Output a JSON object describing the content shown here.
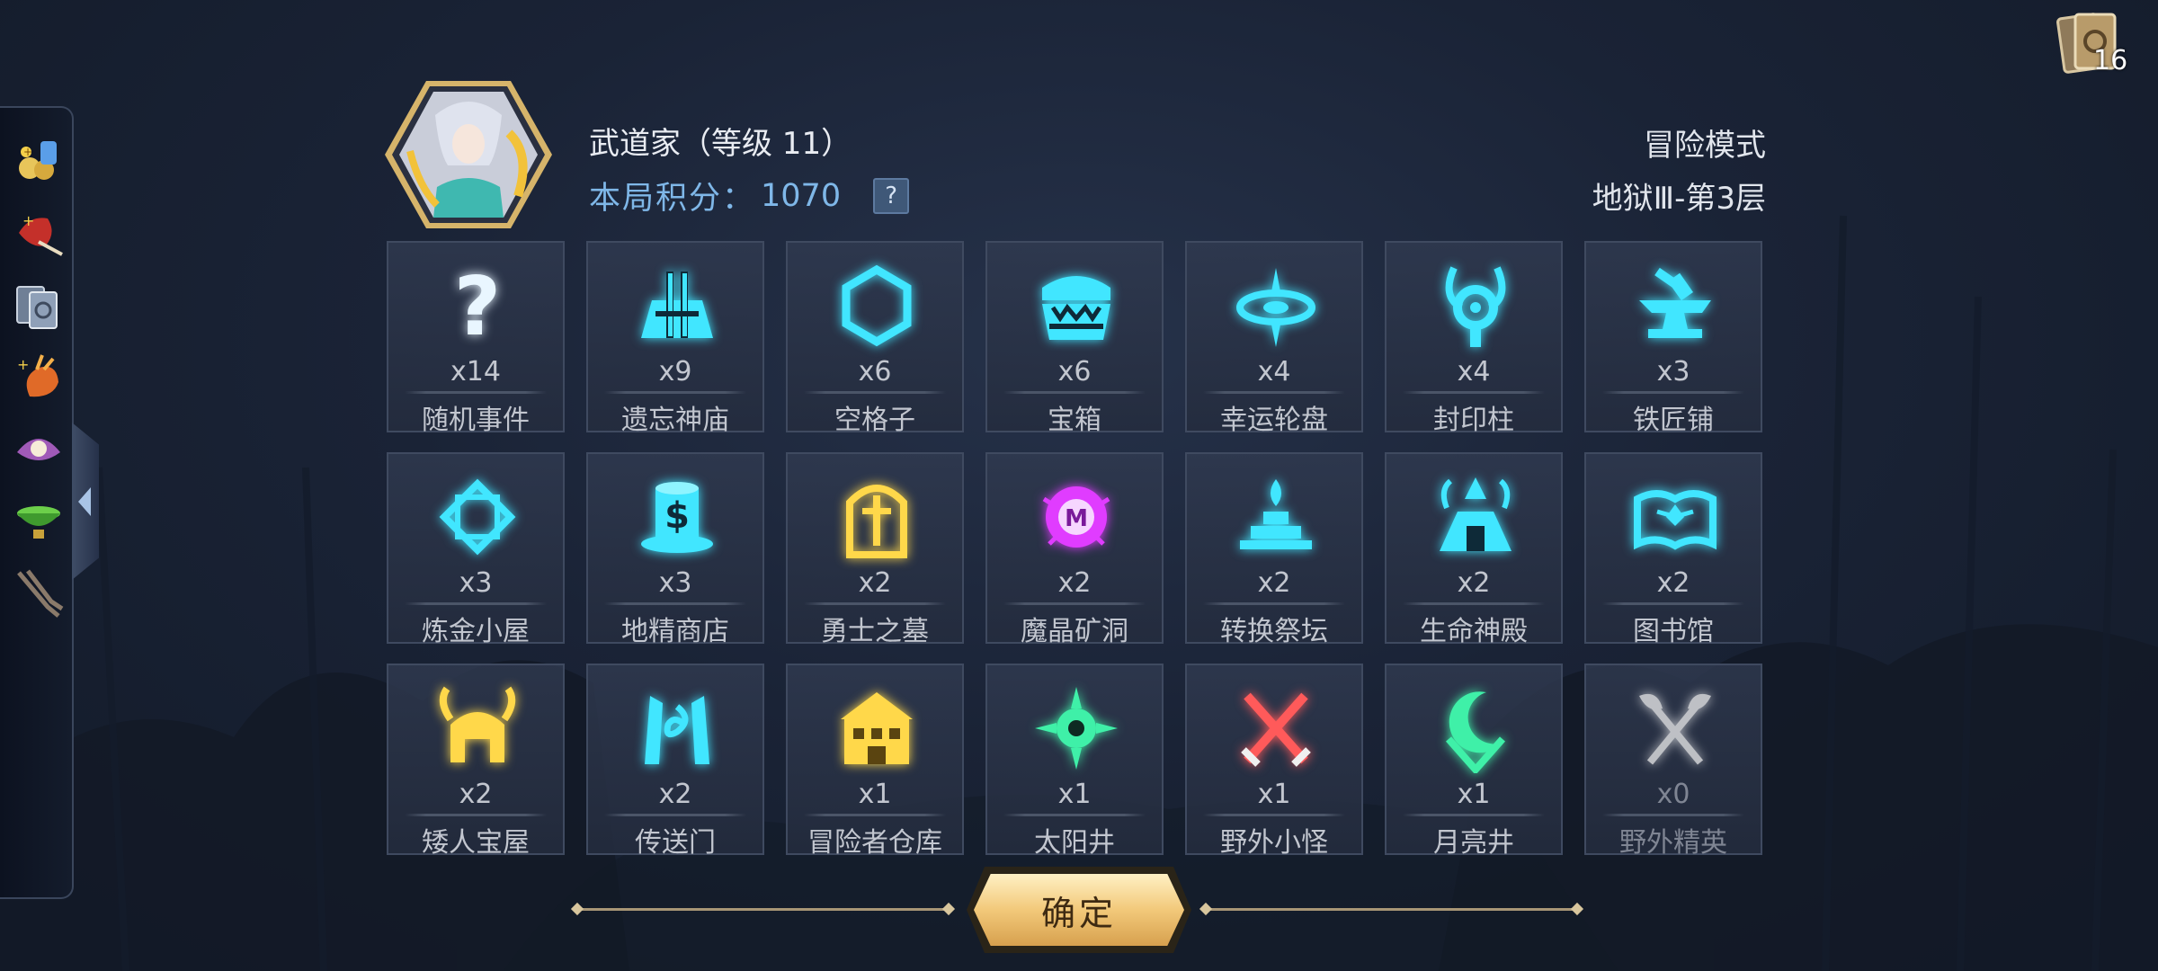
{
  "header": {
    "character_name": "武道家（等级 11）",
    "score_label": "本局积分：",
    "score_value": "1070",
    "help_label": "?",
    "mode": "冒险模式",
    "floor": "地狱Ⅲ-第3层"
  },
  "deck": {
    "count": "16",
    "icon": "card-deck-icon"
  },
  "sidebar": {
    "items": [
      {
        "icon": "gold-coins-relic-icon"
      },
      {
        "icon": "red-horn-relic-icon"
      },
      {
        "icon": "card-stack-relic-icon"
      },
      {
        "icon": "flame-claw-relic-icon"
      },
      {
        "icon": "pearl-shell-relic-icon"
      },
      {
        "icon": "green-bowl-relic-icon"
      },
      {
        "icon": "tongs-relic-icon"
      }
    ],
    "collapse_icon": "chevron-left-icon"
  },
  "colors": {
    "cyan": "#41e6ff",
    "gold": "#ffd84a",
    "purple": "#e03cff",
    "green": "#3ff0a8",
    "red": "#ff4a4a",
    "white": "#f0f0f0"
  },
  "tiles": [
    {
      "count": "x14",
      "label": "随机事件",
      "icon": "question-icon",
      "color": "#e9f6ff"
    },
    {
      "count": "x9",
      "label": "遗忘神庙",
      "icon": "forgotten-temple-icon",
      "color": "#41e6ff"
    },
    {
      "count": "x6",
      "label": "空格子",
      "icon": "hexagon-icon",
      "color": "#41e6ff"
    },
    {
      "count": "x6",
      "label": "宝箱",
      "icon": "treasure-chest-icon",
      "color": "#41e6ff"
    },
    {
      "count": "x4",
      "label": "幸运轮盘",
      "icon": "lucky-wheel-icon",
      "color": "#41e6ff"
    },
    {
      "count": "x4",
      "label": "封印柱",
      "icon": "seal-pillar-icon",
      "color": "#41e6ff"
    },
    {
      "count": "x3",
      "label": "铁匠铺",
      "icon": "anvil-icon",
      "color": "#41e6ff"
    },
    {
      "count": "x3",
      "label": "炼金小屋",
      "icon": "alchemy-icon",
      "color": "#41e6ff"
    },
    {
      "count": "x3",
      "label": "地精商店",
      "icon": "goblin-shop-icon",
      "color": "#41e6ff"
    },
    {
      "count": "x2",
      "label": "勇士之墓",
      "icon": "tombstone-icon",
      "color": "#ffd84a"
    },
    {
      "count": "x2",
      "label": "魔晶矿洞",
      "icon": "magic-crystal-icon",
      "color": "#e03cff"
    },
    {
      "count": "x2",
      "label": "转换祭坛",
      "icon": "altar-icon",
      "color": "#41e6ff"
    },
    {
      "count": "x2",
      "label": "生命神殿",
      "icon": "life-temple-icon",
      "color": "#41e6ff"
    },
    {
      "count": "x2",
      "label": "图书馆",
      "icon": "book-icon",
      "color": "#41e6ff"
    },
    {
      "count": "x2",
      "label": "矮人宝屋",
      "icon": "dwarf-helmet-icon",
      "color": "#ffd84a"
    },
    {
      "count": "x2",
      "label": "传送门",
      "icon": "portal-icon",
      "color": "#41e6ff"
    },
    {
      "count": "x1",
      "label": "冒险者仓库",
      "icon": "warehouse-icon",
      "color": "#ffd84a"
    },
    {
      "count": "x1",
      "label": "太阳井",
      "icon": "sun-well-icon",
      "color": "#3ff0a8"
    },
    {
      "count": "x1",
      "label": "野外小怪",
      "icon": "crossed-swords-icon",
      "color": "#ff5a5a"
    },
    {
      "count": "x1",
      "label": "月亮井",
      "icon": "moon-well-icon",
      "color": "#3ff0a8"
    },
    {
      "count": "x0",
      "label": "野外精英",
      "icon": "crossed-axes-icon",
      "color": "#f0f0f0",
      "dim": true
    }
  ],
  "confirm_label": "确定"
}
